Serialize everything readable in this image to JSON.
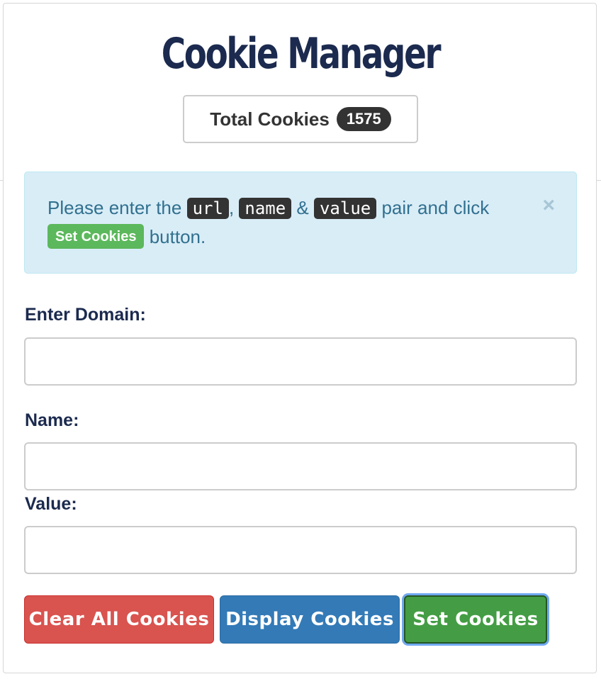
{
  "title": "Cookie Manager",
  "total": {
    "label": "Total Cookies",
    "count": "1575"
  },
  "alert": {
    "text_before": "Please enter the ",
    "code_url": "url",
    "sep1": ", ",
    "code_name": "name",
    "sep2": " & ",
    "code_value": "value",
    "text_after": " pair and click ",
    "inline_button": "Set Cookies",
    "text_end": " button.",
    "close": "×"
  },
  "form": {
    "domain_label": "Enter Domain:",
    "domain_value": "",
    "name_label": "Name:",
    "name_value": "",
    "value_label": "Value:",
    "value_value": ""
  },
  "buttons": {
    "clear": "Clear All Cookies",
    "display": "Display Cookies",
    "set": "Set Cookies"
  },
  "colors": {
    "title": "#1b2a4e",
    "alert_bg": "#d9edf7",
    "alert_text": "#31708f",
    "danger": "#d9534f",
    "primary": "#337ab7",
    "success": "#449d44"
  }
}
